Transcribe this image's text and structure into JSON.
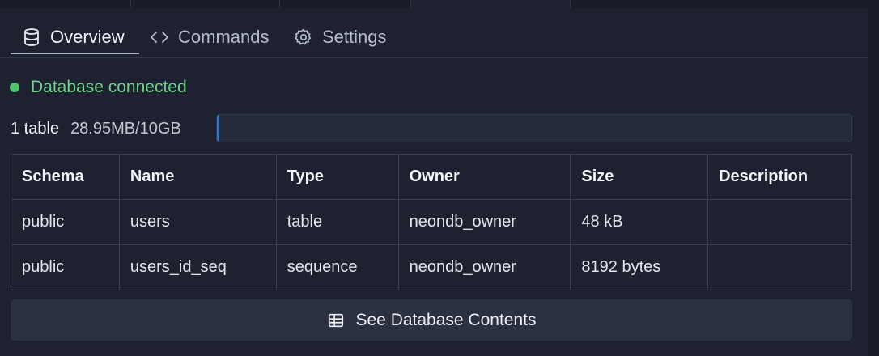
{
  "tabs": [
    {
      "label": "Overview",
      "icon": "database-icon",
      "active": true
    },
    {
      "label": "Commands",
      "icon": "code-icon",
      "active": false
    },
    {
      "label": "Settings",
      "icon": "gear-icon",
      "active": false
    }
  ],
  "status": {
    "text": "Database connected",
    "color": "#4ec46b"
  },
  "usage": {
    "table_count": "1 table",
    "size_text": "28.95MB/10GB",
    "fraction": 0.0029,
    "bar_color": "#2b74d6"
  },
  "table": {
    "headers": [
      "Schema",
      "Name",
      "Type",
      "Owner",
      "Size",
      "Description"
    ],
    "rows": [
      [
        "public",
        "users",
        "table",
        "neondb_owner",
        "48 kB",
        ""
      ],
      [
        "public",
        "users_id_seq",
        "sequence",
        "neondb_owner",
        "8192 bytes",
        ""
      ]
    ]
  },
  "see_button": {
    "label": "See Database Contents",
    "icon": "table-icon"
  }
}
